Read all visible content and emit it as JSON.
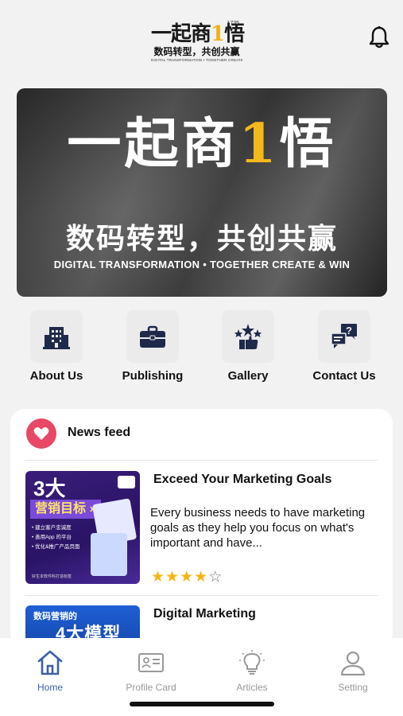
{
  "header": {
    "logo_main_a": "一起商",
    "logo_main_b": "1",
    "logo_main_c": "悟",
    "logo_sup": "1735",
    "logo_sub": "数码转型，共创共赢",
    "logo_tiny": "DIGITAL TRANSFORMATION • TOGETHER CREATE & WIN",
    "bell_icon": "bell-icon"
  },
  "banner": {
    "title_a": "一起商",
    "title_b": "1",
    "title_c": "悟",
    "subtitle": "数码转型，共创共赢",
    "english": "DIGITAL TRANSFORMATION • TOGETHER CREATE & WIN"
  },
  "quick_links": [
    {
      "label": "About Us",
      "icon": "building-icon"
    },
    {
      "label": "Publishing",
      "icon": "briefcase-icon"
    },
    {
      "label": "Gallery",
      "icon": "stars-award-icon"
    },
    {
      "label": "Contact Us",
      "icon": "chat-question-icon"
    }
  ],
  "news": {
    "heading": "News feed",
    "items": [
      {
        "title": "Exceed Your Marketing Goals",
        "description": "Every business needs to have marketing goals as they help you focus on what's important and have...",
        "rating": 4,
        "max_rating": 5,
        "thumb": {
          "big": "3大",
          "band": "营销目标 »",
          "lines": [
            "• 建立客户忠诚度",
            "• 善用App 的平台",
            "• 优化&推广产品页面"
          ],
          "foot": "好生本软件科打造标签"
        }
      },
      {
        "title": "Digital Marketing",
        "thumb": {
          "small": "数码营销的",
          "big": "4大模型"
        }
      }
    ]
  },
  "tabbar": {
    "tabs": [
      {
        "label": "Home",
        "icon": "home-icon",
        "active": true
      },
      {
        "label": "Profile Card",
        "icon": "id-card-icon",
        "active": false
      },
      {
        "label": "Articles",
        "icon": "lightbulb-icon",
        "active": false
      },
      {
        "label": "Setting",
        "icon": "user-icon",
        "active": false
      }
    ]
  },
  "colors": {
    "accent": "#3d5fa8",
    "heart": "#e84766",
    "star": "#f5b514",
    "brand_yellow": "#f2b81c"
  }
}
